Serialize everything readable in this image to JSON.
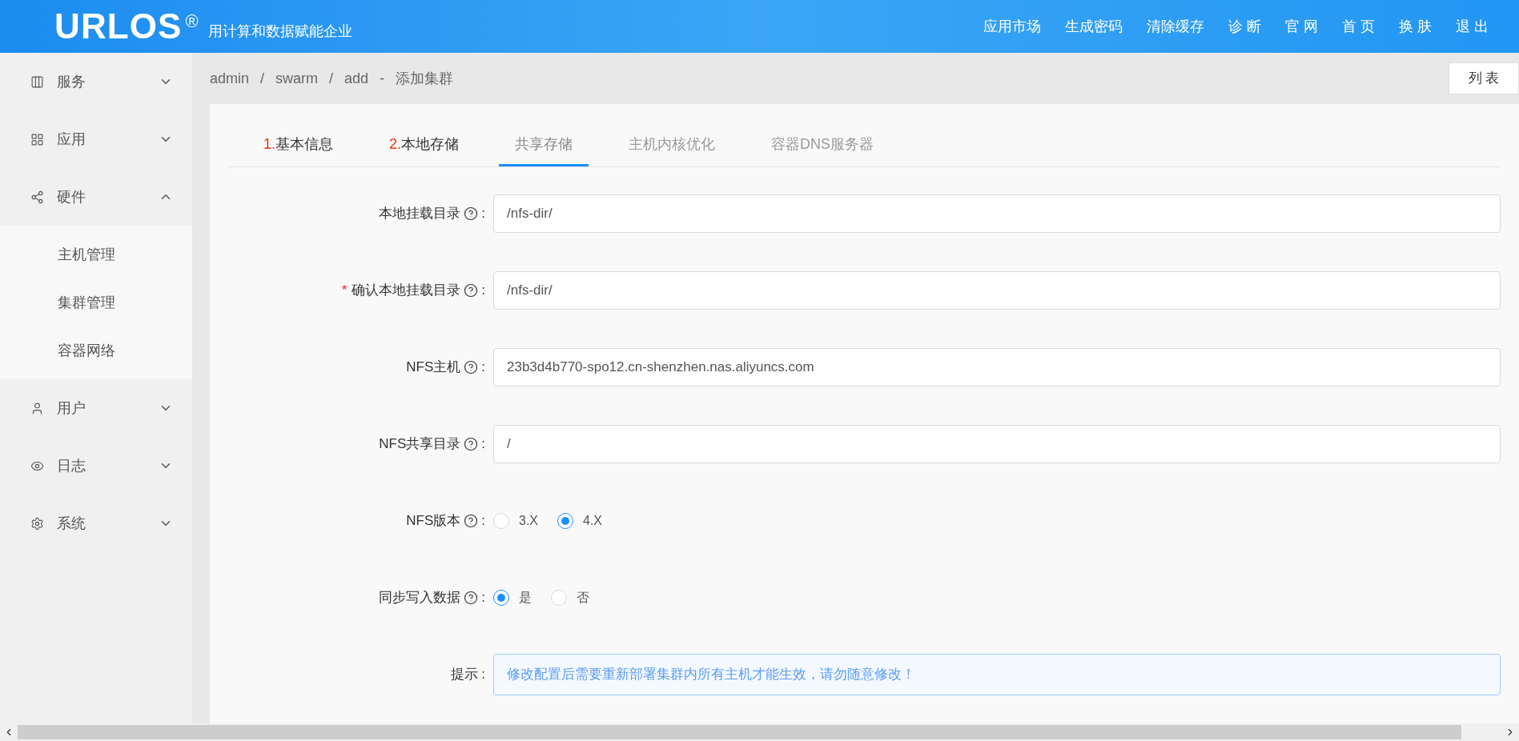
{
  "header": {
    "logo": "URLOS",
    "logo_mark": "®",
    "slogan": "用计算和数据赋能企业",
    "nav": [
      "应用市场",
      "生成密码",
      "清除缓存",
      "诊 断",
      "官 网",
      "首 页",
      "换 肤",
      "退 出"
    ]
  },
  "sidebar": {
    "items": [
      {
        "label": "服务",
        "expanded": false
      },
      {
        "label": "应用",
        "expanded": false
      },
      {
        "label": "硬件",
        "expanded": true,
        "children": [
          {
            "label": "主机管理"
          },
          {
            "label": "集群管理"
          },
          {
            "label": "容器网络"
          }
        ]
      },
      {
        "label": "用户",
        "expanded": false
      },
      {
        "label": "日志",
        "expanded": false
      },
      {
        "label": "系统",
        "expanded": false
      }
    ]
  },
  "breadcrumb": {
    "items": [
      "admin",
      "swarm",
      "add"
    ],
    "separator": "/",
    "title_separator": "-",
    "title": "添加集群"
  },
  "list_button": "列 表",
  "tabs": [
    {
      "number": "1.",
      "label": "基本信息",
      "selected": false
    },
    {
      "number": "2.",
      "label": "本地存储",
      "selected": false
    },
    {
      "label": "共享存储",
      "selected": true
    },
    {
      "label": "主机内核优化",
      "selected": false
    },
    {
      "label": "容器DNS服务器",
      "selected": false
    }
  ],
  "form": [
    {
      "kind": "input",
      "label": "本地挂载目录",
      "required": false,
      "help": true,
      "value": "/nfs-dir/"
    },
    {
      "kind": "input",
      "label": "确认本地挂载目录",
      "required": true,
      "help": true,
      "value": "/nfs-dir/"
    },
    {
      "kind": "input",
      "label": "NFS主机",
      "required": false,
      "help": true,
      "value": "23b3d4b770-spo12.cn-shenzhen.nas.aliyuncs.com"
    },
    {
      "kind": "input",
      "label": "NFS共享目录",
      "required": false,
      "help": true,
      "value": "/"
    },
    {
      "kind": "radio",
      "label": "NFS版本",
      "required": false,
      "help": true,
      "options": [
        {
          "label": "3.X",
          "selected": false
        },
        {
          "label": "4.X",
          "selected": true
        }
      ]
    },
    {
      "kind": "radio",
      "label": "同步写入数据",
      "required": false,
      "help": true,
      "options": [
        {
          "label": "是",
          "selected": true
        },
        {
          "label": "否",
          "selected": false
        }
      ]
    },
    {
      "kind": "alert",
      "label": "提示",
      "required": false,
      "help": false,
      "text": "修改配置后需要重新部署集群内所有主机才能生效，请勿随意修改！"
    }
  ],
  "required_mark": "*",
  "label_colon": ":"
}
